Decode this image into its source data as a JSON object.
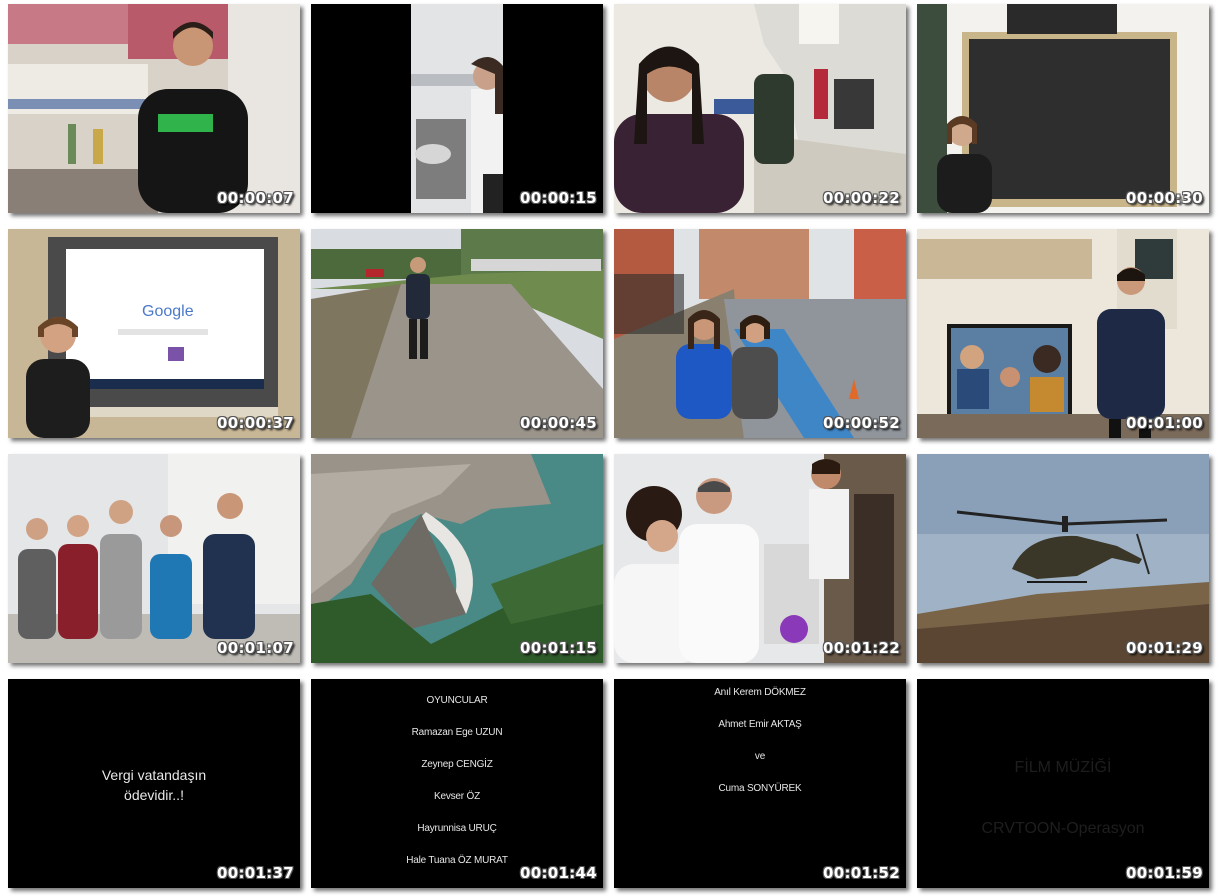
{
  "frames": [
    {
      "id": "f1",
      "time": "00:00:07"
    },
    {
      "id": "f2",
      "time": "00:00:15"
    },
    {
      "id": "f3",
      "time": "00:00:22"
    },
    {
      "id": "f4",
      "time": "00:00:30"
    },
    {
      "id": "f5",
      "time": "00:00:37",
      "screen_text": "Google"
    },
    {
      "id": "f6",
      "time": "00:00:45"
    },
    {
      "id": "f7",
      "time": "00:00:52"
    },
    {
      "id": "f8",
      "time": "00:01:00"
    },
    {
      "id": "f9",
      "time": "00:01:07"
    },
    {
      "id": "f10",
      "time": "00:01:15"
    },
    {
      "id": "f11",
      "time": "00:01:22"
    },
    {
      "id": "f12",
      "time": "00:01:29"
    },
    {
      "id": "f13",
      "time": "00:01:37",
      "caption_lines": [
        "Vergi vatandaşın",
        "ödevidir..!"
      ]
    },
    {
      "id": "f14",
      "time": "00:01:44",
      "credits": [
        "OYUNCULAR",
        "Ramazan Ege UZUN",
        "Zeynep CENGİZ",
        "Kevser ÖZ",
        "Hayrunnisa URUÇ",
        "Hale Tuana ÖZ MURAT"
      ]
    },
    {
      "id": "f15",
      "time": "00:01:52",
      "credits": [
        "Anıl Kerem DÖKMEZ",
        "Ahmet Emir AKTAŞ",
        "ve",
        "Cuma SONYÜREK"
      ]
    },
    {
      "id": "f16",
      "time": "00:01:59",
      "music_title": "FİLM MÜZİĞİ",
      "music_track": "CRVTOON-Operasyon"
    }
  ]
}
